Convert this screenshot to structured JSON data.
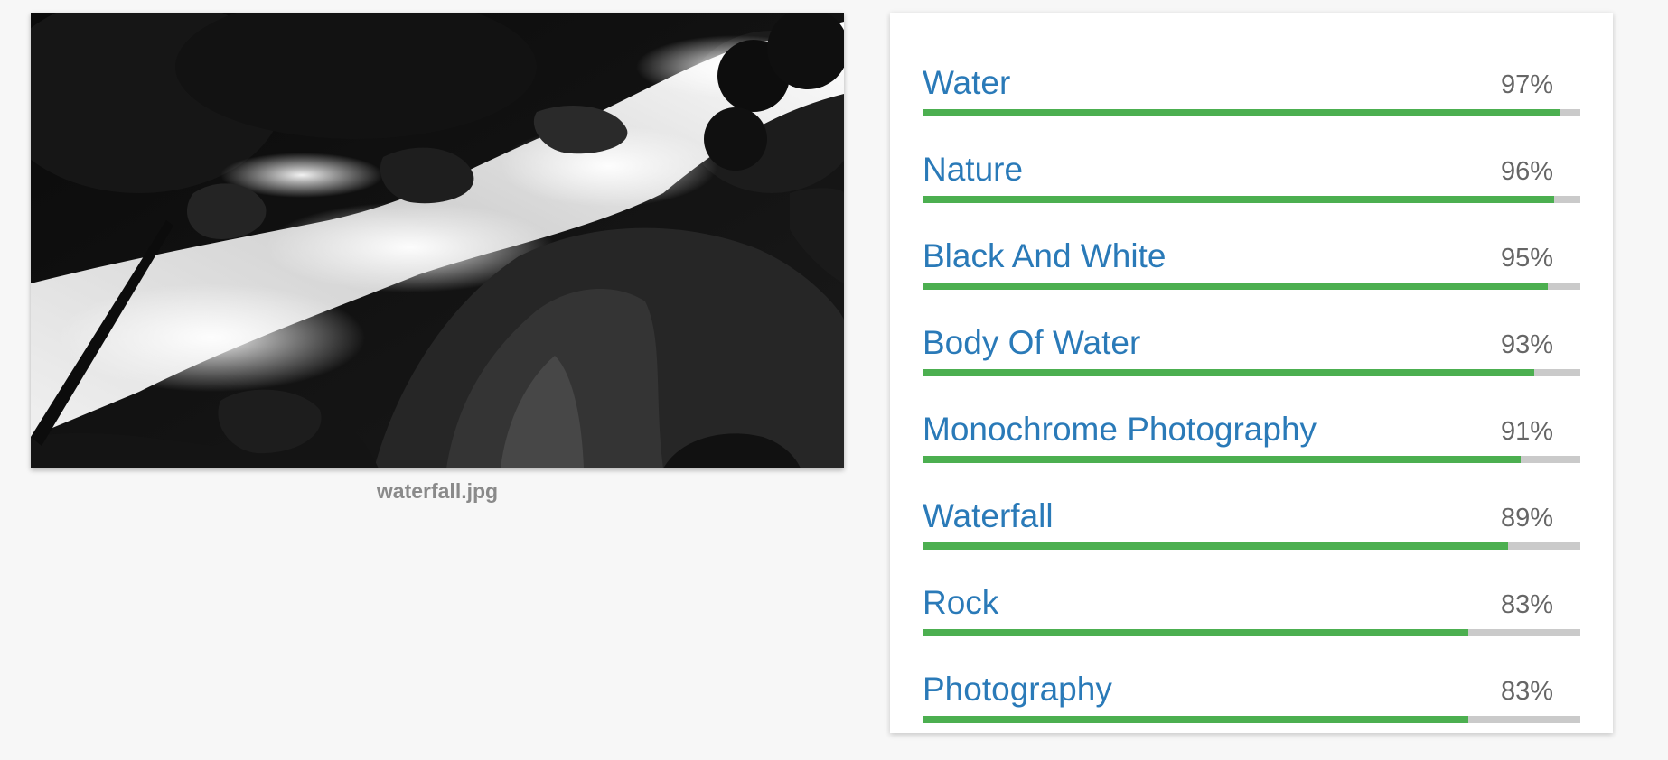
{
  "image": {
    "filename": "waterfall.jpg",
    "alt": "black and white photo of waterfall"
  },
  "colors": {
    "label_text": "#2a7ab8",
    "score_text": "#666666",
    "bar_fill": "#4caf50",
    "bar_track": "#cacaca",
    "background": "#f7f7f7"
  },
  "labels": [
    {
      "name": "Water",
      "score": "97%",
      "value": 0.97
    },
    {
      "name": "Nature",
      "score": "96%",
      "value": 0.96
    },
    {
      "name": "Black And White",
      "score": "95%",
      "value": 0.95
    },
    {
      "name": "Body Of Water",
      "score": "93%",
      "value": 0.93
    },
    {
      "name": "Monochrome Photography",
      "score": "91%",
      "value": 0.91
    },
    {
      "name": "Waterfall",
      "score": "89%",
      "value": 0.89
    },
    {
      "name": "Rock",
      "score": "83%",
      "value": 0.83
    },
    {
      "name": "Photography",
      "score": "83%",
      "value": 0.83
    }
  ]
}
